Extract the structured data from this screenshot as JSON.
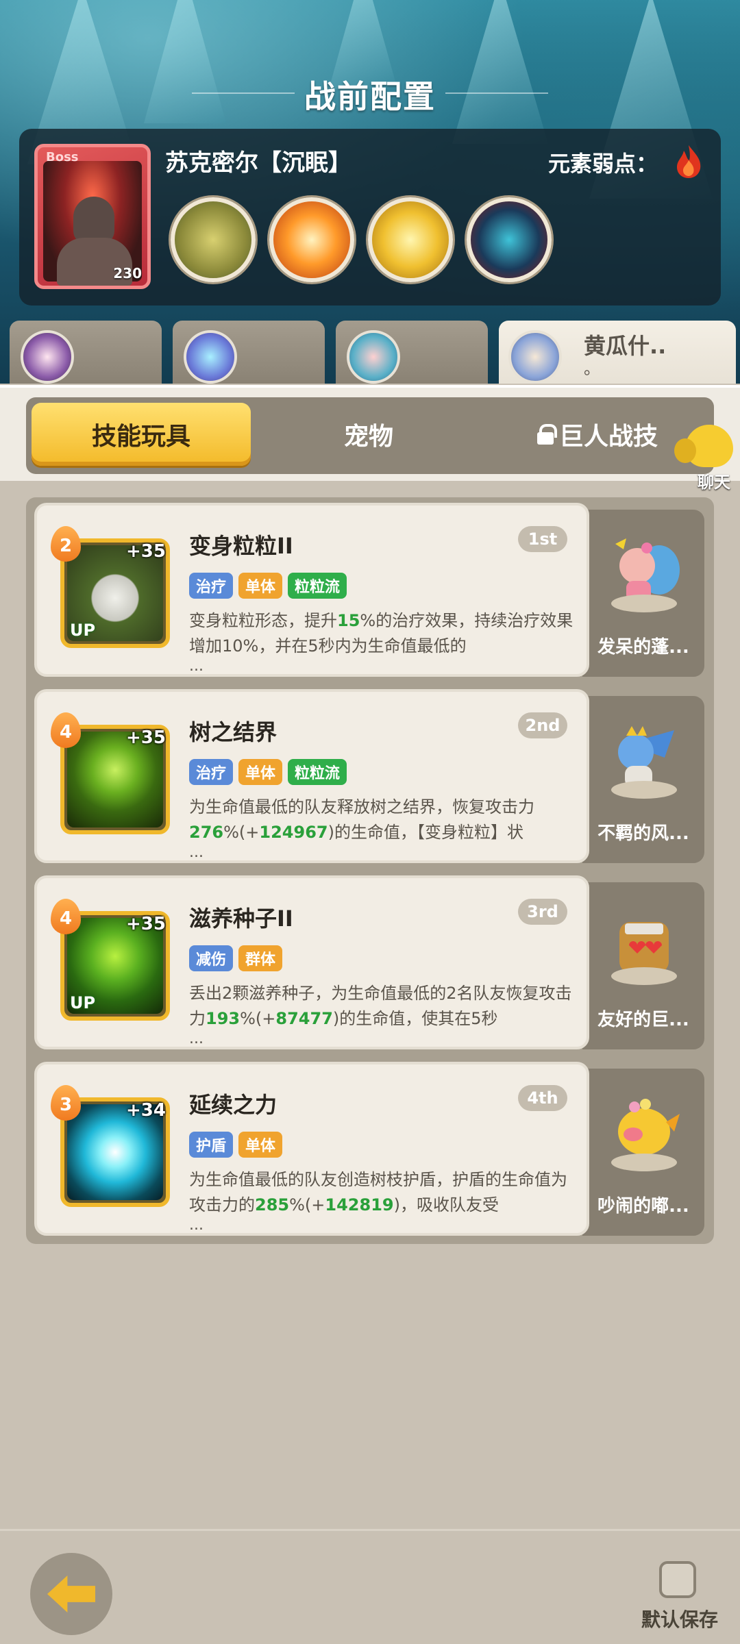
{
  "header": {
    "title": "战前配置"
  },
  "boss": {
    "tag": "Boss",
    "level": "230",
    "name": "苏克密尔【沉眠】",
    "weakness_label": "元素弱点：",
    "weakness_icon": "fire-element-icon"
  },
  "team_tabs": [
    {
      "name": "",
      "sub": ""
    },
    {
      "name": "",
      "sub": ""
    },
    {
      "name": "",
      "sub": ""
    },
    {
      "name": "黄瓜什..",
      "sub": "。"
    }
  ],
  "category_tabs": [
    {
      "label": "技能玩具",
      "active": true
    },
    {
      "label": "宠物",
      "active": false
    },
    {
      "label": "巨人战技",
      "active": false,
      "locked": true
    }
  ],
  "chat": {
    "label": "聊天"
  },
  "skills": [
    {
      "level": "2",
      "plus": "+35",
      "up": "UP",
      "name": "变身粒粒II",
      "rank": "1st",
      "tags": [
        "治疗",
        "单体",
        "粒粒流"
      ],
      "desc_1": "变身粒粒形态，提升",
      "desc_hl_1": "15",
      "desc_2": "%的治疗效果，持续治疗效果增加10%，并在5秒内为生命值最低的",
      "desc_hl_2": "",
      "desc_3": "",
      "pet_name": "发呆的蓬..."
    },
    {
      "level": "4",
      "plus": "+35",
      "up": "",
      "name": "树之结界",
      "rank": "2nd",
      "tags": [
        "治疗",
        "单体",
        "粒粒流"
      ],
      "desc_1": "为生命值最低的队友释放树之结界，恢复攻击力",
      "desc_hl_1": "276",
      "desc_2": "%(+",
      "desc_hl_2": "124967",
      "desc_3": ")的生命值，【变身粒粒】状",
      "pet_name": "不羁的风..."
    },
    {
      "level": "4",
      "plus": "+35",
      "up": "UP",
      "name": "滋养种子II",
      "rank": "3rd",
      "tags": [
        "减伤",
        "群体"
      ],
      "desc_1": "丢出2颗滋养种子，为生命值最低的2名队友恢复攻击力",
      "desc_hl_1": "193",
      "desc_2": "%(+",
      "desc_hl_2": "87477",
      "desc_3": ")的生命值，使其在5秒",
      "pet_name": "友好的巨..."
    },
    {
      "level": "3",
      "plus": "+34",
      "up": "",
      "name": "延续之力",
      "rank": "4th",
      "tags": [
        "护盾",
        "单体"
      ],
      "desc_1": "为生命值最低的队友创造树枝护盾，护盾的生命值为攻击力的",
      "desc_hl_1": "285",
      "desc_2": "%(+",
      "desc_hl_2": "142819",
      "desc_3": ")，吸收队友受",
      "pet_name": "吵闹的嘟..."
    }
  ],
  "ellipsis": "...",
  "footer": {
    "save_label": "默认保存"
  },
  "colors": {
    "accent": "#f3b928",
    "heal_green": "#2aa03a",
    "tag_blue": "#5a8ad8",
    "tag_orange": "#f0a32e",
    "tag_green": "#2fae4a"
  }
}
